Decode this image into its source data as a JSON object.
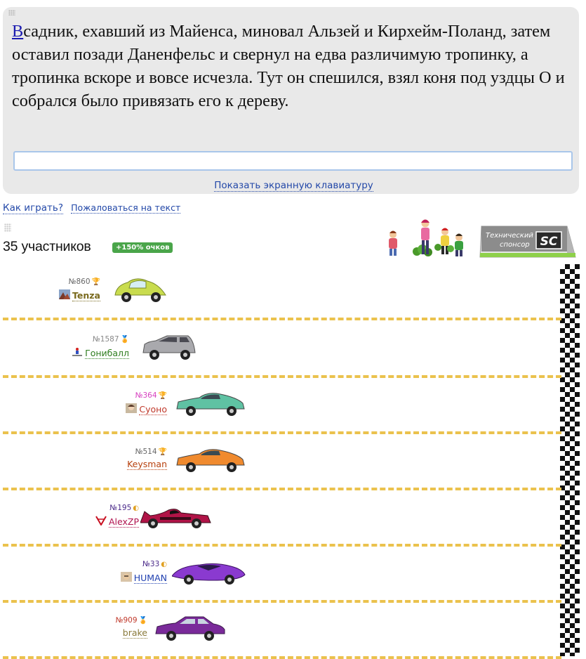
{
  "race_text": {
    "first_letter": "В",
    "rest": "садник, ехавший из Майенса, миновал Альзей и Кирхейм-Поланд, затем оставил позади Даненфельс и свернул на едва различимую тропинку, а тропинка вскоре и вовсе исчезла. Тут он спешился, взял коня под уздцы О и собрался было привязать его к дереву."
  },
  "input": {
    "value": "",
    "placeholder": ""
  },
  "keyboard_link": "Показать экранную клавиатуру",
  "links": {
    "how_to_play": "Как играть?",
    "complain": "Пожаловаться на текст"
  },
  "participants_label": "35 участников",
  "bonus_badge": "+150% очков",
  "sponsor": {
    "line1": "Технический",
    "line2": "спонсор",
    "logo": "SC"
  },
  "players": [
    {
      "rank": "№860",
      "name": "Tenza",
      "name_color": "#7a6a1e",
      "bold": true,
      "rank_color": "#666666",
      "trophy": "🏆",
      "trophy_color": "#d4a017",
      "avatar": "landscape",
      "car": "beetle",
      "car_color": "#c9dc4e"
    },
    {
      "rank": "№1587",
      "name": "Гонибалл",
      "name_color": "#2e7d1e",
      "bold": false,
      "rank_color": "#888888",
      "trophy": "🏅",
      "trophy_color": "#e08a2a",
      "avatar": "skier",
      "car": "hatch",
      "car_color": "#a9a9ad"
    },
    {
      "rank": "№364",
      "name": "Cyоно",
      "name_color": "#c0392b",
      "bold": false,
      "rank_color": "#d63fbf",
      "trophy": "🏆",
      "trophy_color": "#d4a017",
      "avatar": "photo",
      "car": "coupe",
      "car_color": "#5fc2a3"
    },
    {
      "rank": "№514",
      "name": "Keysman",
      "name_color": "#b7410e",
      "bold": false,
      "rank_color": "#666666",
      "trophy": "🏆",
      "trophy_color": "#d4a017",
      "avatar": "none",
      "car": "coupe",
      "car_color": "#f08a2e"
    },
    {
      "rank": "№195",
      "name": "AlexZP",
      "name_color": "#b0124f",
      "bold": false,
      "rank_color": "#4b2a8a",
      "trophy": "◐",
      "trophy_color": "#e0a020",
      "avatar": "logo",
      "car": "batmobile",
      "car_color": "#b01447"
    },
    {
      "rank": "№33",
      "name": "HUMAN",
      "name_color": "#2040b0",
      "bold": false,
      "rank_color": "#4b2a8a",
      "trophy": "◐",
      "trophy_color": "#e0a020",
      "avatar": "photo2",
      "car": "concept",
      "car_color": "#8a3ad0"
    },
    {
      "rank": "№909",
      "name": "brake",
      "name_color": "#8a7a3a",
      "bold": false,
      "rank_color": "#c0392b",
      "trophy": "🏅",
      "trophy_color": "#e08a2a",
      "avatar": "none",
      "car": "sedan",
      "car_color": "#7a2a9a"
    }
  ]
}
